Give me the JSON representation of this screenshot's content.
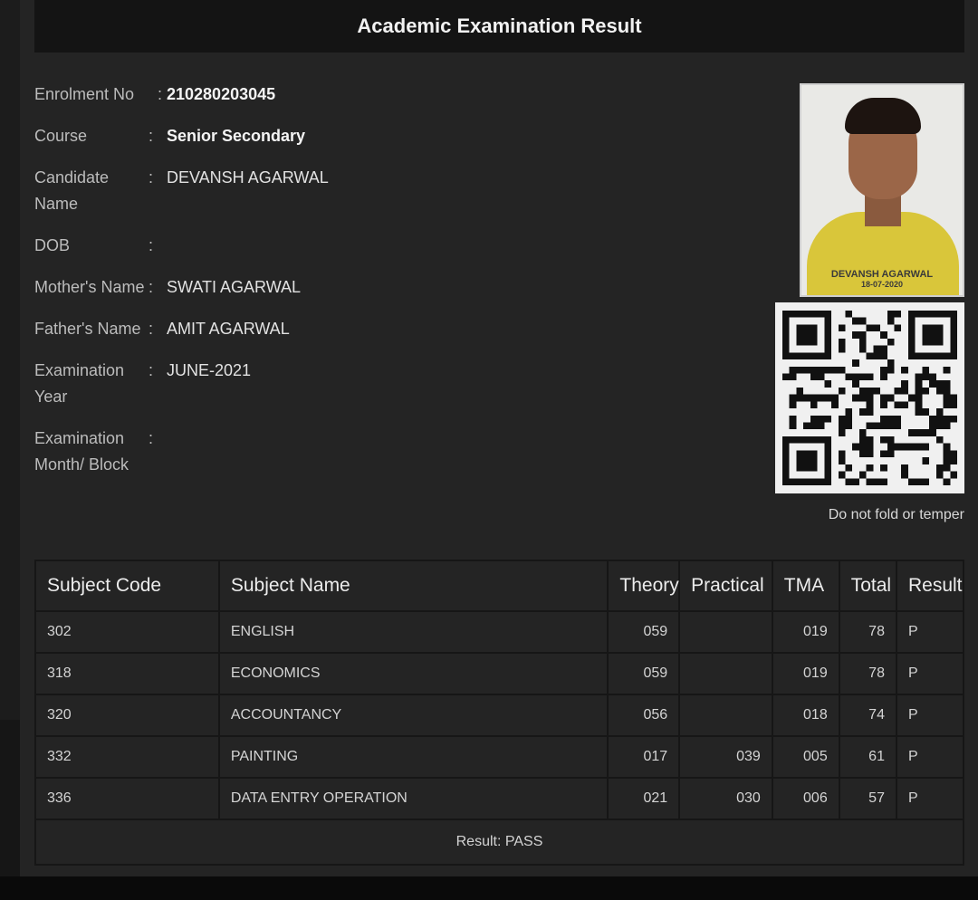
{
  "header": {
    "title": "Academic Examination Result"
  },
  "candidate": {
    "fields": [
      {
        "label": "Enrolment No",
        "value": "210280203045"
      },
      {
        "label": "Course",
        "value": "Senior Secondary"
      },
      {
        "label": "Candidate Name",
        "value": "DEVANSH AGARWAL"
      },
      {
        "label": "DOB",
        "value": ""
      },
      {
        "label": "Mother's Name",
        "value": "SWATI AGARWAL"
      },
      {
        "label": "Father's Name",
        "value": "AMIT AGARWAL"
      },
      {
        "label": "Examination Year",
        "value": "JUNE-2021"
      },
      {
        "label": "Examination Month/ Block",
        "value": ""
      }
    ],
    "colon": ":",
    "photo_caption": "DEVANSH AGARWAL",
    "photo_date": "18-07-2020",
    "notice": "Do not fold or temper"
  },
  "results": {
    "headers": [
      "Subject Code",
      "Subject Name",
      "Theory",
      "Practical",
      "TMA",
      "Total",
      "Result"
    ],
    "rows": [
      [
        "302",
        "ENGLISH",
        "059",
        "",
        "019",
        "78",
        "P"
      ],
      [
        "318",
        "ECONOMICS",
        "059",
        "",
        "019",
        "78",
        "P"
      ],
      [
        "320",
        "ACCOUNTANCY",
        "056",
        "",
        "018",
        "74",
        "P"
      ],
      [
        "332",
        "PAINTING",
        "017",
        "039",
        "005",
        "61",
        "P"
      ],
      [
        "336",
        "DATA ENTRY OPERATION",
        "021",
        "030",
        "006",
        "57",
        "P"
      ]
    ],
    "summary": "Result: PASS"
  },
  "colors": {
    "background": "#242424",
    "title_bar": "#141414",
    "border": "#161616"
  }
}
